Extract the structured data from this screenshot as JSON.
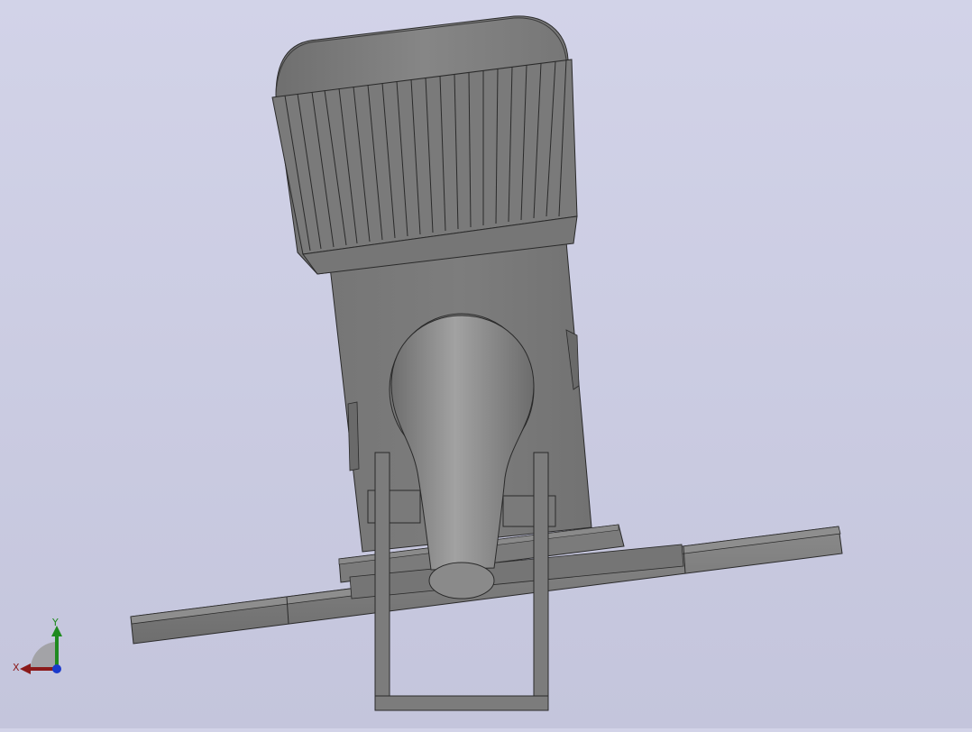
{
  "viewport": {
    "background_top": "#d2d3e8",
    "background_bottom": "#c4c5dc",
    "model_color": "#7d7d7d"
  },
  "triad": {
    "x_label": "X",
    "y_label": "Y",
    "x_color": "#8b1a1a",
    "y_color": "#1f8a1f",
    "z_color": "#1a3acc"
  }
}
